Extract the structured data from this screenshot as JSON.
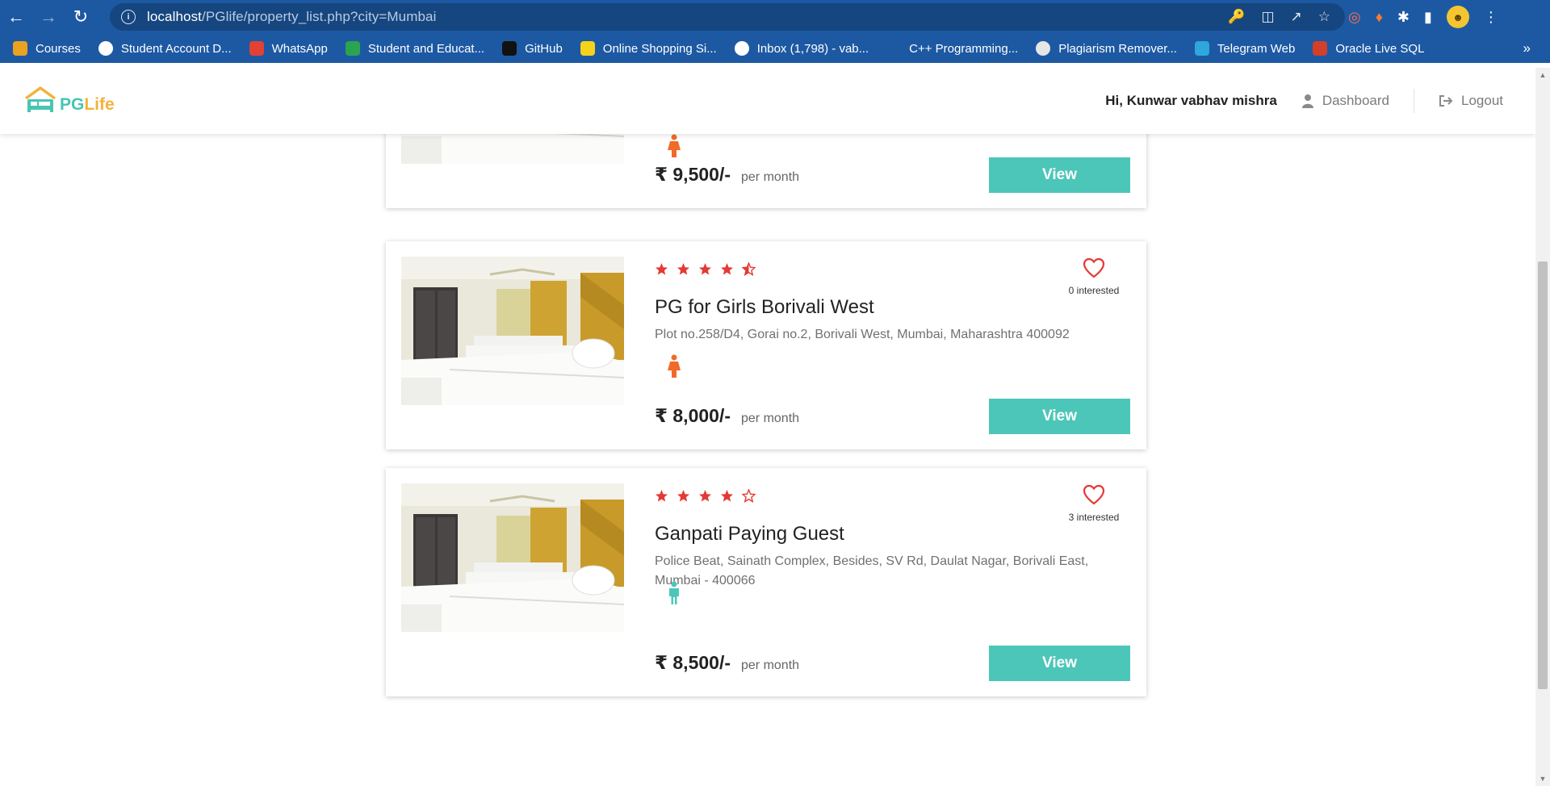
{
  "browser": {
    "url_host": "localhost",
    "url_path": "/PGlife/property_list.php?city=Mumbai",
    "bookmarks": [
      {
        "label": "Courses",
        "icon": "courses-icon",
        "color": "#e9a321"
      },
      {
        "label": "Student Account D...",
        "icon": "globe-icon",
        "color": "#ffffff"
      },
      {
        "label": "WhatsApp",
        "icon": "alert-icon",
        "color": "#e34133"
      },
      {
        "label": "Student and Educat...",
        "icon": "drive-icon",
        "color": "#2aa44f"
      },
      {
        "label": "GitHub",
        "icon": "github-icon",
        "color": "#111111"
      },
      {
        "label": "Online Shopping Si...",
        "icon": "flipkart-icon",
        "color": "#f6d31a"
      },
      {
        "label": "Inbox (1,798) - vab...",
        "icon": "gmail-icon",
        "color": "#ffffff"
      },
      {
        "label": "C++ Programming...",
        "icon": "infinity-icon",
        "color": "#1d59a3"
      },
      {
        "label": "Plagiarism Remover...",
        "icon": "pr-icon",
        "color": "#e6e6e6"
      },
      {
        "label": "Telegram Web",
        "icon": "telegram-icon",
        "color": "#2ea6de"
      },
      {
        "label": "Oracle Live SQL",
        "icon": "oracle-icon",
        "color": "#d23f2a"
      }
    ],
    "more": "»"
  },
  "header": {
    "logo_pg": "PG",
    "logo_life": "Life",
    "greeting": "Hi, Kunwar vabhav mishra",
    "dashboard": "Dashboard",
    "logout": "Logout"
  },
  "properties": [
    {
      "name": "",
      "address": "",
      "rating": 0,
      "interested": "",
      "gender": "female",
      "rent": "₹ 9,500/-",
      "per": "per month",
      "view": "View"
    },
    {
      "name": "PG for Girls Borivali West",
      "address": "Plot no.258/D4, Gorai no.2, Borivali West, Mumbai, Maharashtra 400092",
      "rating": 4.5,
      "interested": "0 interested",
      "gender": "female",
      "rent": "₹ 8,000/-",
      "per": "per month",
      "view": "View"
    },
    {
      "name": "Ganpati Paying Guest",
      "address": "Police Beat, Sainath Complex, Besides, SV Rd, Daulat Nagar, Borivali East, Mumbai - 400066",
      "rating": 4,
      "interested": "3 interested",
      "gender": "unisex",
      "rent": "₹ 8,500/-",
      "per": "per month",
      "view": "View"
    }
  ],
  "colors": {
    "accent": "#4cc6b8",
    "star": "#e53935",
    "female": "#f26a2a",
    "unisex": "#4cc6b8"
  }
}
